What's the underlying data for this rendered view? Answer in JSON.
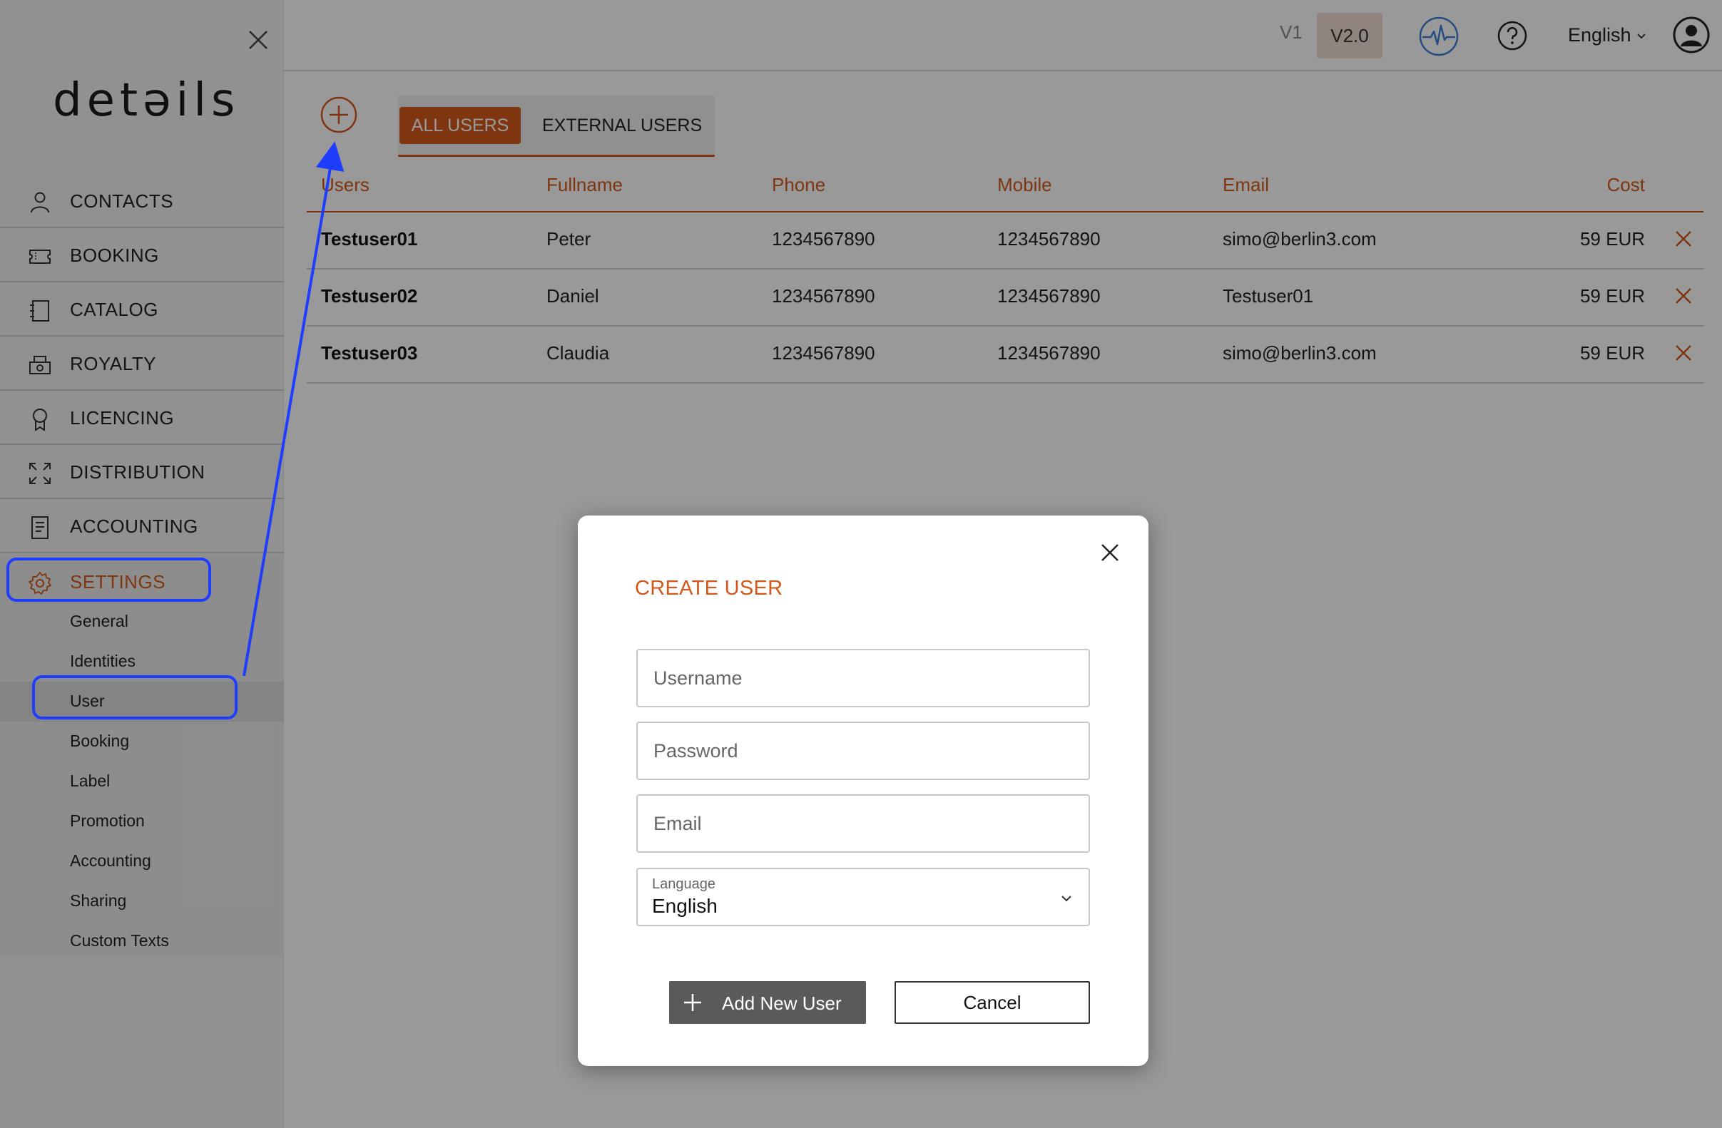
{
  "app": {
    "logo_text": "detəils"
  },
  "sidebar": {
    "items": [
      {
        "key": "contacts",
        "label": "CONTACTS",
        "icon": "person-icon"
      },
      {
        "key": "booking",
        "label": "BOOKING",
        "icon": "ticket-icon"
      },
      {
        "key": "catalog",
        "label": "CATALOG",
        "icon": "catalog-icon"
      },
      {
        "key": "royalty",
        "label": "ROYALTY",
        "icon": "cash-register-icon"
      },
      {
        "key": "licencing",
        "label": "LICENCING",
        "icon": "award-icon"
      },
      {
        "key": "distribution",
        "label": "DISTRIBUTION",
        "icon": "expand-arrows-icon"
      },
      {
        "key": "accounting",
        "label": "ACCOUNTING",
        "icon": "document-icon"
      },
      {
        "key": "settings",
        "label": "SETTINGS",
        "icon": "gear-icon",
        "active": true
      }
    ],
    "settings_subitems": [
      {
        "label": "General"
      },
      {
        "label": "Identities"
      },
      {
        "label": "User",
        "active": true
      },
      {
        "label": "Booking"
      },
      {
        "label": "Label"
      },
      {
        "label": "Promotion"
      },
      {
        "label": "Accounting"
      },
      {
        "label": "Sharing"
      },
      {
        "label": "Custom Texts"
      }
    ]
  },
  "header": {
    "version_v1": "V1",
    "version_v2": "V2.0",
    "language": "English",
    "icons": [
      "pulse-icon",
      "help-icon",
      "user-avatar-icon"
    ]
  },
  "main": {
    "tabs": [
      {
        "label": "ALL USERS",
        "active": true
      },
      {
        "label": "EXTERNAL USERS",
        "active": false
      }
    ],
    "table": {
      "columns": [
        "Users",
        "Fullname",
        "Phone",
        "Mobile",
        "Email",
        "Cost"
      ],
      "rows": [
        {
          "user": "Testuser01",
          "fullname": "Peter",
          "phone": "1234567890",
          "mobile": "1234567890",
          "email": "simo@berlin3.com",
          "cost": "59 EUR"
        },
        {
          "user": "Testuser02",
          "fullname": "Daniel",
          "phone": "1234567890",
          "mobile": "1234567890",
          "email": "Testuser01",
          "cost": "59 EUR"
        },
        {
          "user": "Testuser03",
          "fullname": "Claudia",
          "phone": "1234567890",
          "mobile": "1234567890",
          "email": "simo@berlin3.com",
          "cost": "59 EUR"
        }
      ]
    }
  },
  "modal": {
    "title": "CREATE USER",
    "username_placeholder": "Username",
    "password_placeholder": "Password",
    "email_placeholder": "Email",
    "language_label": "Language",
    "language_value": "English",
    "add_button": "Add New User",
    "cancel_button": "Cancel"
  },
  "colors": {
    "accent": "#d2591c",
    "annotation": "#1f3dff",
    "overlay": "rgba(0,0,0,0.4)",
    "version_active_bg": "#f0dcd2",
    "pulse_icon": "#3d7fd8"
  }
}
